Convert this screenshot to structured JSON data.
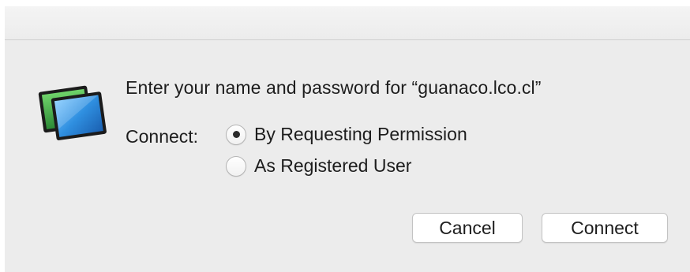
{
  "dialog": {
    "prompt": "Enter your name and password for “guanaco.lco.cl”",
    "connect_label": "Connect:",
    "options": [
      {
        "label": "By Requesting Permission",
        "selected": true
      },
      {
        "label": "As Registered User",
        "selected": false
      }
    ],
    "buttons": {
      "cancel": "Cancel",
      "connect": "Connect"
    }
  },
  "icon": "screen-sharing-icon",
  "colors": {
    "window_bg": "#ececec",
    "icon_green": "#3fa54a",
    "icon_blue": "#2f8fe0"
  }
}
